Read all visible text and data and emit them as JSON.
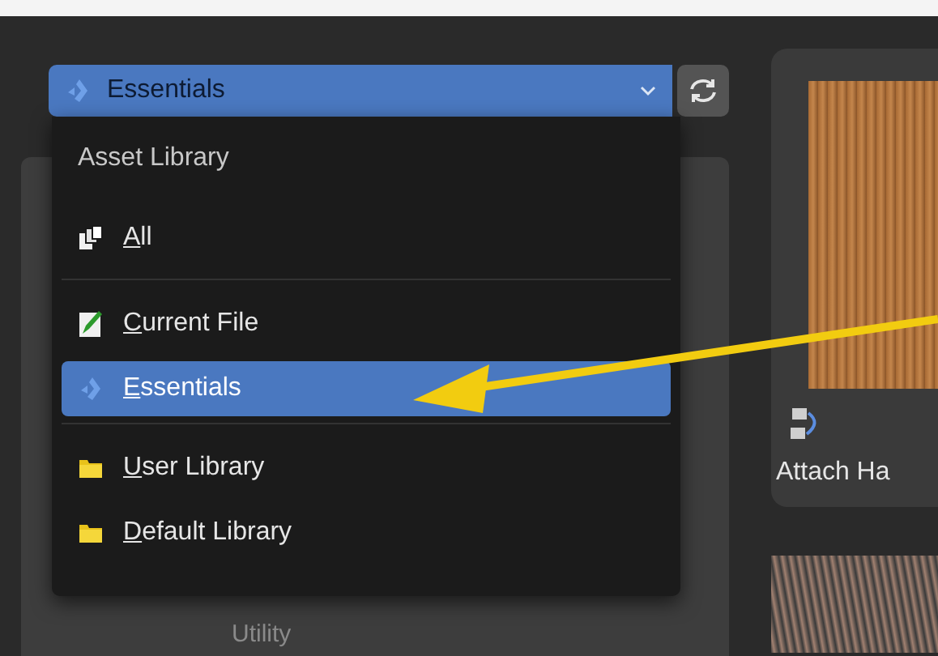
{
  "library_selector": {
    "value": "Essentials"
  },
  "menu": {
    "title": "Asset Library",
    "sections": [
      {
        "items": [
          {
            "label": "All",
            "kind": "all",
            "selected": false
          }
        ]
      },
      {
        "items": [
          {
            "label": "Current File",
            "kind": "current",
            "selected": false
          },
          {
            "label": "Essentials",
            "kind": "bundled",
            "selected": true
          }
        ]
      },
      {
        "items": [
          {
            "label": "User Library",
            "kind": "custom",
            "selected": false
          },
          {
            "label": "Default Library",
            "kind": "custom",
            "selected": false
          }
        ]
      }
    ]
  },
  "catalog_tree": {
    "visible_item": "Utility"
  },
  "assets": [
    {
      "name": "Attach Ha"
    }
  ]
}
